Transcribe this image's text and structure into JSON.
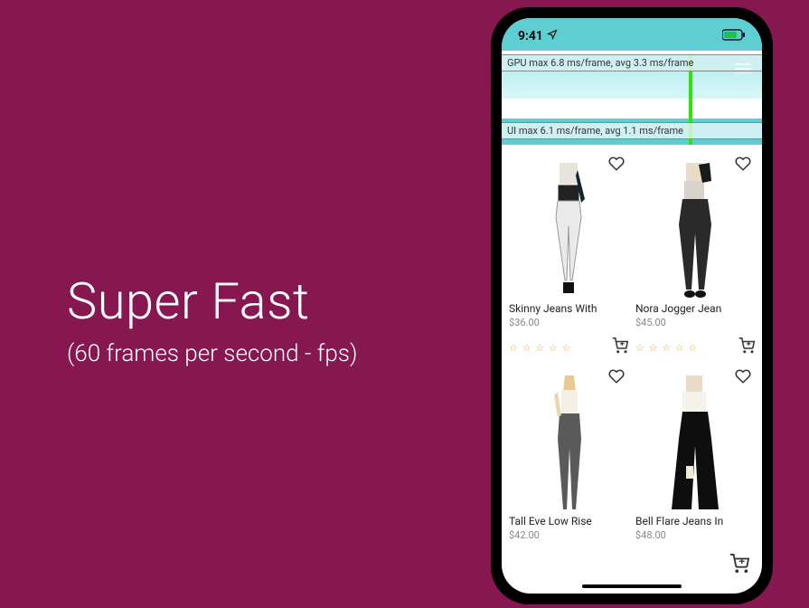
{
  "slide": {
    "title": "Super Fast",
    "subtitle": "(60 frames per second - fps)"
  },
  "status": {
    "time": "9:41",
    "location_icon": "location-arrow-icon",
    "battery_icon": "battery-icon"
  },
  "perf": {
    "gpu_label": "GPU  max 6.8 ms/frame, avg 3.3 ms/frame",
    "ui_label": "UI  max 6.1 ms/frame, avg 1.1 ms/frame"
  },
  "products": [
    {
      "title": "Skinny Jeans With",
      "price": "$36.00",
      "rating": 0
    },
    {
      "title": "Nora Jogger Jean",
      "price": "$45.00",
      "rating": 0
    },
    {
      "title": "Tall Eve Low Rise",
      "price": "$42.00",
      "rating": 0
    },
    {
      "title": "Bell Flare Jeans In",
      "price": "$48.00",
      "rating": 0
    }
  ],
  "stars_glyph": "☆ ☆ ☆ ☆ ☆"
}
